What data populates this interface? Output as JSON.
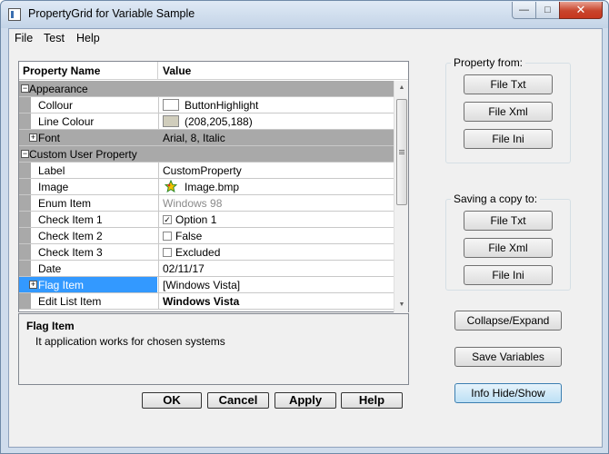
{
  "window": {
    "title": "PropertyGrid for Variable Sample",
    "minimize": "—",
    "maximize": "□",
    "close": "✕"
  },
  "menu": [
    "File",
    "Test",
    "Help"
  ],
  "grid": {
    "header": {
      "name": "Property Name",
      "value": "Value"
    },
    "rows": [
      {
        "type": "category",
        "name": "Appearance",
        "expander": "−"
      },
      {
        "type": "prop",
        "name": "Collour",
        "value": "ButtonHighlight",
        "swatch": "#ffffff"
      },
      {
        "type": "prop",
        "name": "Line Colour",
        "value": "(208,205,188)",
        "swatch": "#d0cdbc"
      },
      {
        "type": "category-prop",
        "name": "Font",
        "value": "Arial, 8, Italic",
        "expander": "+"
      },
      {
        "type": "category",
        "name": "Custom User Property",
        "expander": "−"
      },
      {
        "type": "prop",
        "name": "Label",
        "value": "CustomProperty"
      },
      {
        "type": "prop",
        "name": "Image",
        "value": "Image.bmp",
        "icon": "star-icon"
      },
      {
        "type": "prop",
        "name": "Enum Item",
        "value": "Windows 98",
        "disabled": true
      },
      {
        "type": "prop",
        "name": "Check Item 1",
        "value": "Option 1",
        "check": "✓"
      },
      {
        "type": "prop",
        "name": "Check Item 2",
        "value": "False",
        "check": ""
      },
      {
        "type": "prop",
        "name": "Check Item 3",
        "value": "Excluded",
        "check": ""
      },
      {
        "type": "prop",
        "name": "Date",
        "value": "02/11/17"
      },
      {
        "type": "prop",
        "name": "Flag Item",
        "value": "[Windows Vista]",
        "expander": "+",
        "selected": true
      },
      {
        "type": "prop",
        "name": "Edit List Item",
        "value": "Windows Vista",
        "bold": true
      }
    ]
  },
  "help": {
    "title": "Flag Item",
    "description": "It application works for chosen systems"
  },
  "dialog_buttons": {
    "ok": "OK",
    "cancel": "Cancel",
    "apply": "Apply",
    "help": "Help"
  },
  "property_from": {
    "title": "Property from:",
    "buttons": [
      "File Txt",
      "File Xml",
      "File Ini"
    ]
  },
  "saving_copy": {
    "title": "Saving a copy to:",
    "buttons": [
      "File Txt",
      "File Xml",
      "File Ini"
    ]
  },
  "side_buttons": {
    "collapse": "Collapse/Expand",
    "save": "Save Variables",
    "info": "Info Hide/Show"
  }
}
